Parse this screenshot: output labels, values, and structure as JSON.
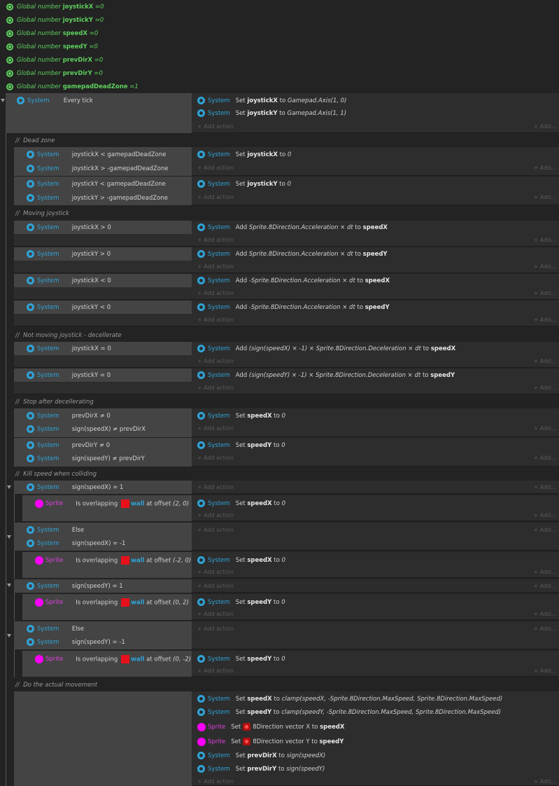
{
  "globals": [
    {
      "name": "joystickX",
      "value": "0"
    },
    {
      "name": "joystickY",
      "value": "0"
    },
    {
      "name": "speedX",
      "value": "0"
    },
    {
      "name": "speedY",
      "value": "0"
    },
    {
      "name": "prevDirX",
      "value": "0"
    },
    {
      "name": "prevDirY",
      "value": "0"
    },
    {
      "name": "gamepadDeadZone",
      "value": "1"
    }
  ],
  "labels": {
    "global_prefix": "Global number",
    "eq": "= ",
    "system": "System",
    "sprite": "Sprite",
    "add_action": "+ Add action",
    "add": "+ Add...",
    "set": "Set",
    "to": "to",
    "add_word": "Add",
    "is_overlapping": "Is overlapping",
    "at_offset": "at offset",
    "wall": "wall",
    "else": "Else",
    "every_tick": "Every tick",
    "dir_x": "8Direction vector X to",
    "dir_y": "8Direction vector Y to"
  },
  "comments": [
    "Dead zone",
    "Moving joystick",
    "Not moving joystick - decellerate",
    "Stop after decellerating",
    "Kill speed when colliding",
    "Do the actual movement"
  ],
  "conditions": {
    "c1a": "joystickX < gamepadDeadZone",
    "c1b": "joystickX > -gamepadDeadZone",
    "c2a": "joystickY < gamepadDeadZone",
    "c2b": "joystickY > -gamepadDeadZone",
    "c3": "joystickX > 0",
    "c4": "joystickY > 0",
    "c5": "joystickX < 0",
    "c6": "joystickY < 0",
    "c7": "joystickX = 0",
    "c8": "joystickY = 0",
    "c9a": "prevDirX ≠ 0",
    "c9b": "sign(speedX) ≠ prevDirX",
    "c10a": "prevDirY ≠ 0",
    "c10b": "sign(speedY) ≠ prevDirY",
    "k1": "sign(speedX) = 1",
    "k2": "sign(speedX) = -1",
    "k3": "sign(speedY) = 1",
    "k4": "sign(speedY) = -1"
  },
  "actions": {
    "a0a_var": "joystickX",
    "a0a_expr": "Gamepad.Axis(1, 0)",
    "a0b_var": "joystickY",
    "a0b_expr": "Gamepad.Axis(1, 1)",
    "zero": "0",
    "acc": "Sprite.8Direction.Acceleration × dt",
    "nacc": "-Sprite.8Direction.Acceleration × dt",
    "decx": "(sign(speedX) × -1) × Sprite.8Direction.Deceleration × dt",
    "decy": "(sign(speedY) × -1) × Sprite.8Direction.Deceleration × dt",
    "off1": "(2, 0)",
    "off2": "(-2, 0)",
    "off3": "(0, 2)",
    "off4": "(0, -2)",
    "clampx": "clamp(speedX, -Sprite.8Direction.MaxSpeed, Sprite.8Direction.MaxSpeed)",
    "clampy": "clamp(speedY, -Sprite.8Direction.MaxSpeed, Sprite.8Direction.MaxSpeed)",
    "signx": "sign(speedX)",
    "signy": "sign(speedY)"
  },
  "colors": {
    "background": "#232323",
    "event": "#2d2d2d",
    "condition": "#444444",
    "system": "#2fa4d8",
    "sprite": "#ff00ff",
    "global": "#5ed05e",
    "wall": "#e8111b"
  }
}
